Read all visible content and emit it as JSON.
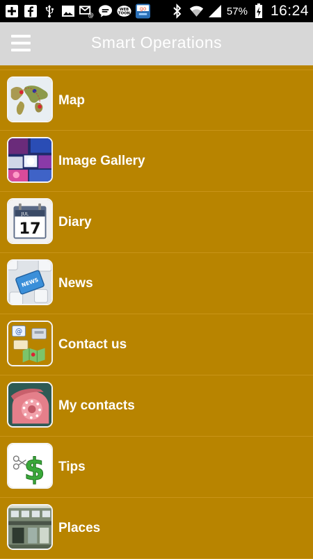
{
  "status_bar": {
    "battery_percent": "57%",
    "time": "16:24",
    "icons": [
      "plus-icon",
      "facebook-icon",
      "usb-icon",
      "image-icon",
      "email-icon",
      "chat-icon",
      "webtoon-icon",
      "go-app-icon",
      "bluetooth-icon",
      "wifi-icon",
      "signal-icon",
      "battery-icon"
    ]
  },
  "app_bar": {
    "title": "Smart Operations",
    "menu_icon": "hamburger-menu-icon"
  },
  "menu": {
    "items": [
      {
        "label": "Map",
        "icon": "map-icon"
      },
      {
        "label": "Image Gallery",
        "icon": "gallery-icon"
      },
      {
        "label": "Diary",
        "icon": "calendar-icon"
      },
      {
        "label": "News",
        "icon": "news-key-icon"
      },
      {
        "label": "Contact us",
        "icon": "contact-icon"
      },
      {
        "label": "My contacts",
        "icon": "phone-icon"
      },
      {
        "label": "Tips",
        "icon": "dollar-icon"
      },
      {
        "label": "Places",
        "icon": "building-icon"
      }
    ]
  },
  "colors": {
    "background": "#b88400",
    "app_bar": "#d7d7d7",
    "status_bar": "#000000",
    "text": "#ffffff"
  }
}
